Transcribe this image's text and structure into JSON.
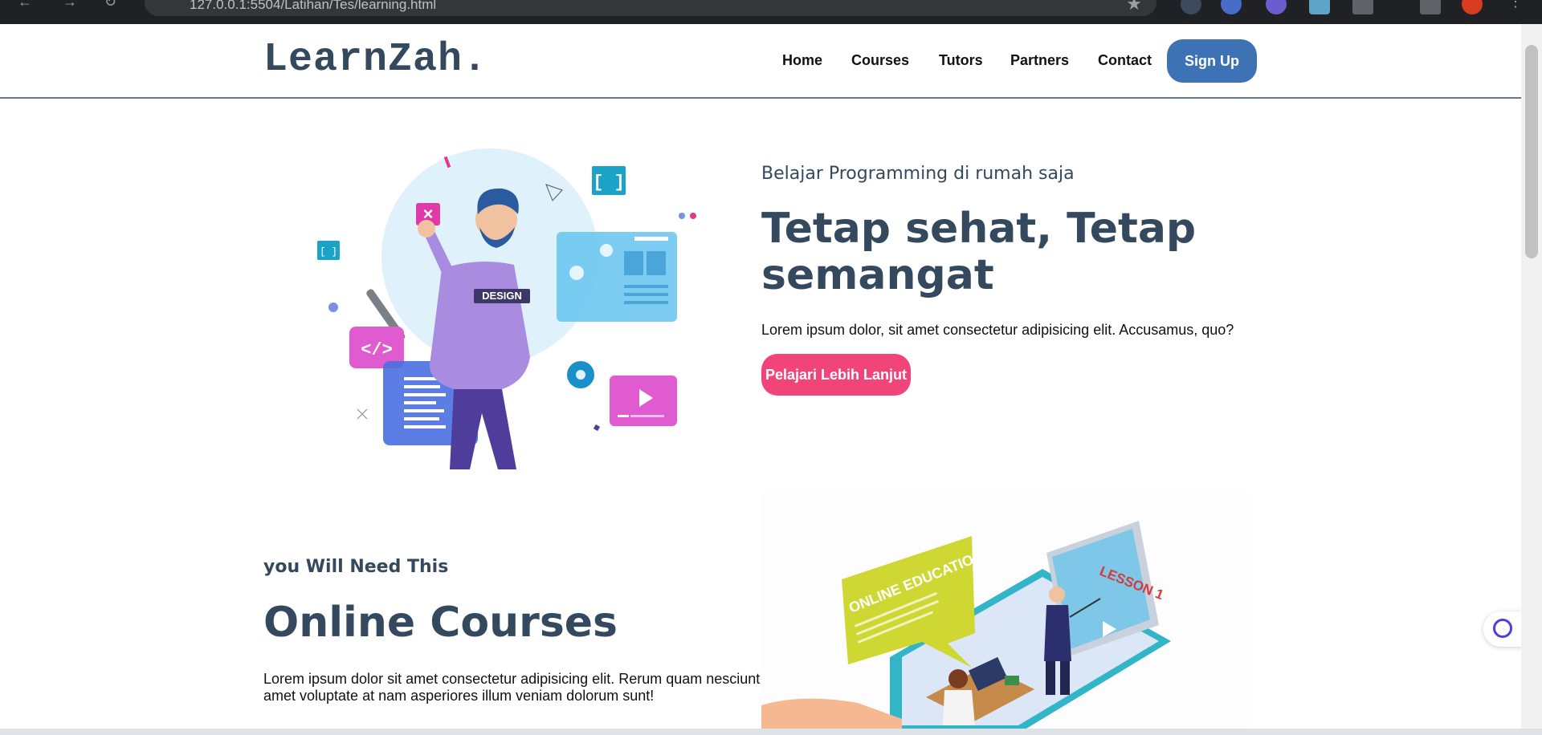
{
  "browser": {
    "url": "127.0.0.1:5504/Latihan/Tes/learning.html",
    "back_icon": "arrow-left-icon",
    "forward_icon": "arrow-right-icon",
    "reload_icon": "reload-icon",
    "bookmark_icon": "star-icon"
  },
  "header": {
    "logo": "LearnZah.",
    "nav": [
      "Home",
      "Courses",
      "Tutors",
      "Partners",
      "Contact"
    ],
    "signup_label": "Sign Up"
  },
  "hero": {
    "subtitle": "Belajar Programming di rumah saja",
    "title": "Tetap sehat, Tetap semangat",
    "text": "Lorem ipsum dolor, sit amet consectetur adipisicing elit. Accusamus, quo?",
    "cta_label": "Pelajari Lebih Lanjut",
    "badge_text": "DESIGN"
  },
  "courses": {
    "subtitle": "you Will Need This",
    "title": "Online Courses",
    "text": "Lorem ipsum dolor sit amet consectetur adipisicing elit. Rerum quam nesciunt amet voluptate at nam asperiores illum veniam dolorum sunt!",
    "bubble_title": "ONLINE EDUCATION",
    "screen_label": "LESSON 1"
  },
  "colors": {
    "brand": "#34495e",
    "signup": "#3d72b5",
    "cta": "#f1457a"
  }
}
